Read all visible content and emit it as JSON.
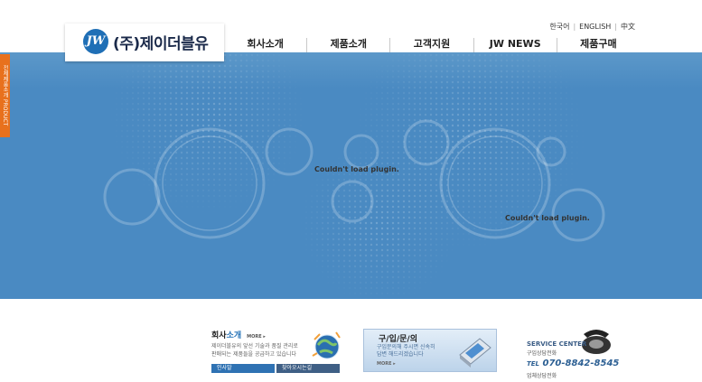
{
  "company": {
    "logo_mark": "JW",
    "name": "(주)제이더블유"
  },
  "languages": [
    "한국어",
    "ENGLISH",
    "中文"
  ],
  "nav": [
    "회사소개",
    "제품소개",
    "고객지원",
    "JW NEWS",
    "제품구매"
  ],
  "side_tab": "전체제품소개 PRODUCT",
  "plugin_messages": [
    "Couldn't load plugin.",
    "Couldn't load plugin."
  ],
  "company_intro": {
    "title_prefix": "회사",
    "title_accent": "소개",
    "more": "MORE ▸",
    "desc_lines": [
      "제이더블유의 앞선 기술과 품질 관리로",
      "판매되는 제품들을 공급하고 있습니다"
    ],
    "buttons": [
      "인사말",
      "찾아오시는길"
    ]
  },
  "inquiry": {
    "title": "구/입/문/의",
    "desc_lines": [
      "구입문의해 주시면 신속히",
      "답변 해드리겠습니다"
    ],
    "more": "MORE ▸"
  },
  "service": {
    "center": "SERVICE CENTER",
    "center_sub": "구입상담전화",
    "tel_prefix": "TEL",
    "tel": "070-8842-8545",
    "sub": "업체상담전화"
  },
  "colors": {
    "hero_blue": "#4a8ac2",
    "accent_blue": "#1f6fb6",
    "side_tab_orange": "#e8711d"
  }
}
